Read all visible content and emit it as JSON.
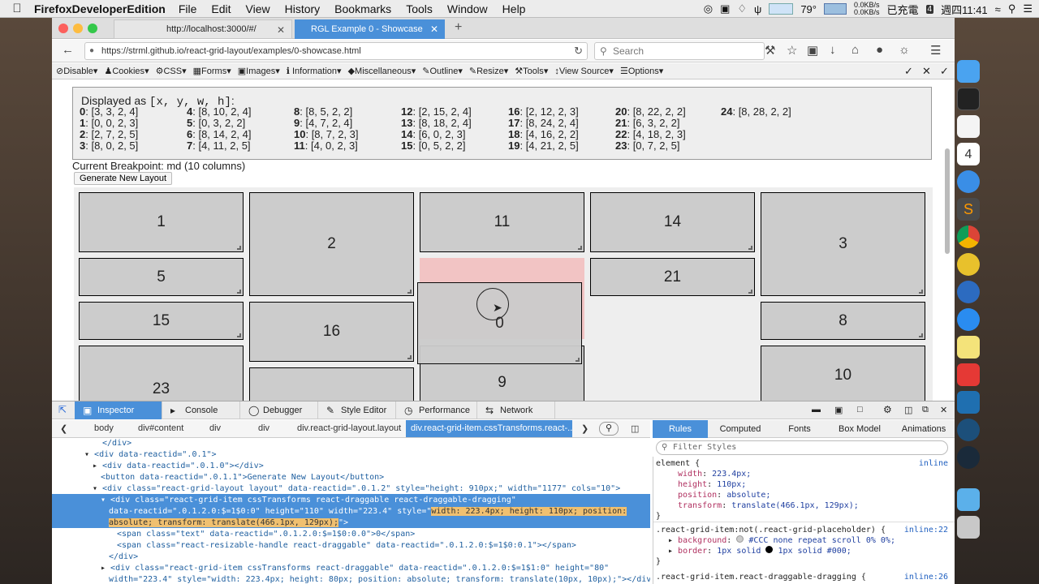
{
  "menubar": {
    "app": "FirefoxDeveloperEdition",
    "items": [
      "File",
      "Edit",
      "View",
      "History",
      "Bookmarks",
      "Tools",
      "Window",
      "Help"
    ],
    "temp": "79°",
    "net_up": "0.0KB/s",
    "net_down": "0.0KB/s",
    "battery": "已充電",
    "clock": "週四11:41",
    "date_badge": "4"
  },
  "tabs": [
    {
      "title": "http://localhost:3000/#/"
    },
    {
      "title": "RGL Example 0 - Showcase"
    }
  ],
  "nav": {
    "url": "https://strml.github.io/react-grid-layout/examples/0-showcase.html",
    "search_placeholder": "Search"
  },
  "webdev": [
    "Disable",
    "Cookies",
    "CSS",
    "Forms",
    "Images",
    "Information",
    "Miscellaneous",
    "Outline",
    "Resize",
    "Tools",
    "View Source",
    "Options"
  ],
  "page": {
    "heading_prefix": "Displayed as",
    "heading_mono": "[x, y, w, h]",
    "heading_suffix": ":",
    "columns": [
      [
        {
          "k": "0",
          "v": ": [3, 3, 2, 4]"
        },
        {
          "k": "1",
          "v": ": [0, 0, 2, 3]"
        },
        {
          "k": "2",
          "v": ": [2, 7, 2, 5]"
        },
        {
          "k": "3",
          "v": ": [8, 0, 2, 5]"
        }
      ],
      [
        {
          "k": "4",
          "v": ": [8, 10, 2, 4]"
        },
        {
          "k": "5",
          "v": ": [0, 3, 2, 2]"
        },
        {
          "k": "6",
          "v": ": [8, 14, 2, 4]"
        },
        {
          "k": "7",
          "v": ": [4, 11, 2, 5]"
        }
      ],
      [
        {
          "k": "8",
          "v": ": [8, 5, 2, 2]"
        },
        {
          "k": "9",
          "v": ": [4, 7, 2, 4]"
        },
        {
          "k": "10",
          "v": ": [8, 7, 2, 3]"
        },
        {
          "k": "11",
          "v": ": [4, 0, 2, 3]"
        }
      ],
      [
        {
          "k": "12",
          "v": ": [2, 15, 2, 4]"
        },
        {
          "k": "13",
          "v": ": [8, 18, 2, 4]"
        },
        {
          "k": "14",
          "v": ": [6, 0, 2, 3]"
        },
        {
          "k": "15",
          "v": ": [0, 5, 2, 2]"
        }
      ],
      [
        {
          "k": "16",
          "v": ": [2, 12, 2, 3]"
        },
        {
          "k": "17",
          "v": ": [8, 24, 2, 4]"
        },
        {
          "k": "18",
          "v": ": [4, 16, 2, 2]"
        },
        {
          "k": "19",
          "v": ": [4, 21, 2, 5]"
        }
      ],
      [
        {
          "k": "20",
          "v": ": [8, 22, 2, 2]"
        },
        {
          "k": "21",
          "v": ": [6, 3, 2, 2]"
        },
        {
          "k": "22",
          "v": ": [4, 18, 2, 3]"
        },
        {
          "k": "23",
          "v": ": [0, 7, 2, 5]"
        }
      ],
      [
        {
          "k": "24",
          "v": ": [8, 28, 2, 2]"
        }
      ]
    ],
    "breakpoint": "Current Breakpoint: md (10 columns)",
    "generate_button": "Generate New Layout",
    "grid_labels": {
      "g1": "1",
      "g2": "2",
      "g11": "11",
      "g14": "14",
      "g3": "3",
      "g5": "5",
      "g21": "21",
      "g15": "15",
      "g16": "16",
      "g0": "0",
      "g8": "8",
      "g23": "23",
      "g9": "9",
      "g10": "10"
    }
  },
  "devtools": {
    "tabs": [
      "Inspector",
      "Console",
      "Debugger",
      "Style Editor",
      "Performance",
      "Network"
    ],
    "crumbs": [
      "body",
      "div#content",
      "div",
      "div",
      "div.react-grid-layout.layout",
      "div.react-grid-item.cssTransforms.react-..."
    ],
    "right_tabs": [
      "Rules",
      "Computed",
      "Fonts",
      "Box Model",
      "Animations"
    ],
    "filter_placeholder": "Filter Styles",
    "markup": [
      "</div>",
      "<div data-reactid=\".0.1\">",
      "<div data-reactid=\".0.1.0\"></div>",
      "<button data-reactid=\".0.1.1\">Generate New Layout</button>",
      "<div class=\"react-grid-layout layout\" data-reactid=\".0.1.2\" style=\"height: 910px;\" width=\"1177\" cols=\"10\">",
      "<div class=\"react-grid-item cssTransforms react-draggable react-draggable-dragging\"",
      "data-reactid=\".0.1.2.0:$=1$0:0\" height=\"110\" width=\"223.4\" style=\"",
      "width: 223.4px; height: 110px; position:",
      "absolute; transform: translate(466.1px, 129px);",
      "\">",
      "<span class=\"text\" data-reactid=\".0.1.2.0:$=1$0:0.0\">0</span>",
      "<span class=\"react-resizable-handle react-draggable\" data-reactid=\".0.1.2.0:$=1$0:0.1\"></span>",
      "</div>",
      "<div class=\"react-grid-item cssTransforms react-draggable\" data-reactid=\".0.1.2.0:$=1$1:0\" height=\"80\"",
      "width=\"223.4\" style=\"width: 223.4px; height: 80px; position: absolute; transform: translate(10px, 10px);\"></div>"
    ],
    "rules": [
      {
        "sel": "element {",
        "src": "inline"
      },
      {
        "prop": "width",
        "val": "223.4px;"
      },
      {
        "prop": "height",
        "val": "110px;"
      },
      {
        "prop": "position",
        "val": "absolute;"
      },
      {
        "prop": "transform",
        "val": "translate(466.1px, 129px);"
      },
      {
        "close": "}"
      },
      {
        "sel": ".react-grid-item:not(.react-grid-placeholder) {",
        "src": "inline:22"
      },
      {
        "prop": "background",
        "val": "#CCC none repeat scroll 0% 0%;"
      },
      {
        "prop": "border",
        "val": "1px solid #000;"
      },
      {
        "close": "}"
      },
      {
        "sel": ".react-grid-item.react-draggable-dragging {",
        "src": "inline:26"
      }
    ]
  }
}
